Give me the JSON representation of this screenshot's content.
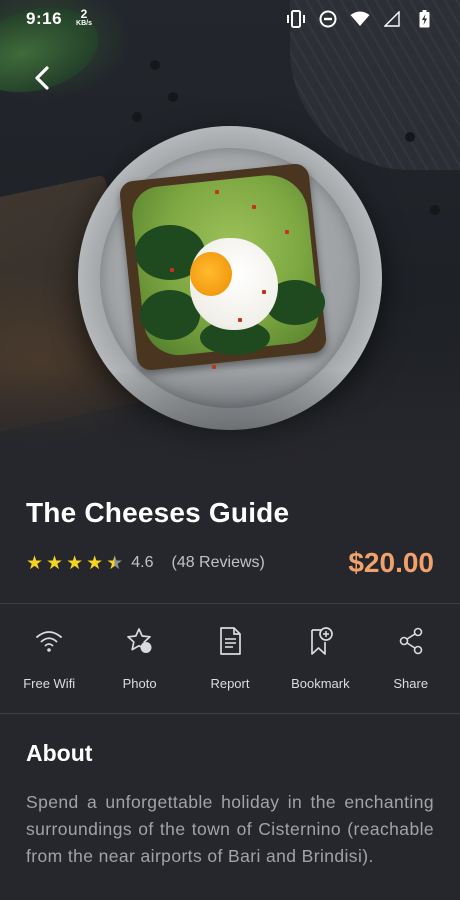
{
  "status_bar": {
    "time": "9:16",
    "kb_value": "2",
    "kb_unit": "KB/s",
    "icons": [
      "vibrate-icon",
      "do-not-disturb-icon",
      "wifi-icon",
      "cell-signal-icon",
      "battery-charging-icon"
    ]
  },
  "header": {
    "back_icon": "chevron-left-icon"
  },
  "listing": {
    "title": "The Cheeses Guide",
    "rating": 4.5,
    "rating_text": "4.6",
    "reviews_text": "(48 Reviews)",
    "price": "$20.00"
  },
  "actions": [
    {
      "icon": "wifi-icon",
      "label": "Free Wifi"
    },
    {
      "icon": "photo-star-icon",
      "label": "Photo"
    },
    {
      "icon": "report-document-icon",
      "label": "Report"
    },
    {
      "icon": "bookmark-add-icon",
      "label": "Bookmark"
    },
    {
      "icon": "share-icon",
      "label": "Share"
    }
  ],
  "about": {
    "heading": "About",
    "body": "Spend a unforgettable holiday in the enchanting surroundings of the town of Cisternino (reachable from the near airports of Bari and Brindisi)."
  },
  "colors": {
    "background": "#26272c",
    "price": "#f3a16c",
    "star": "#f5d324",
    "muted_text": "#a0a3a8"
  }
}
